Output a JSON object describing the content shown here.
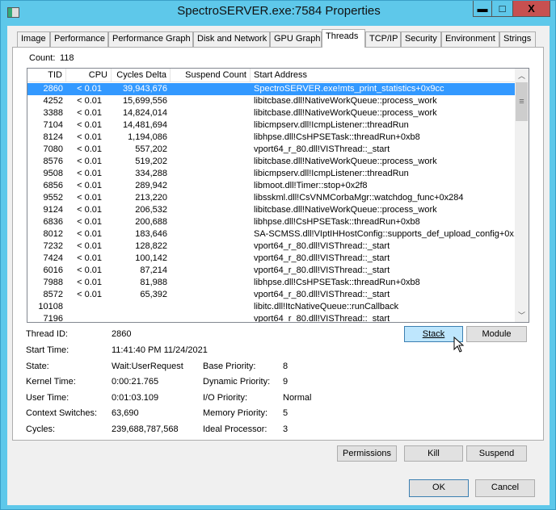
{
  "window": {
    "title": "SpectroSERVER.exe:7584 Properties",
    "minimize": "▬",
    "maximize": "□",
    "close": "X"
  },
  "tabs": [
    "Image",
    "Performance",
    "Performance Graph",
    "Disk and Network",
    "GPU Graph",
    "Threads",
    "TCP/IP",
    "Security",
    "Environment",
    "Strings"
  ],
  "selected_tab": "Threads",
  "count": {
    "label": "Count:",
    "value": "118"
  },
  "columns": [
    "TID",
    "CPU",
    "Cycles Delta",
    "Suspend Count",
    "Start Address"
  ],
  "rows": [
    [
      "2860",
      "< 0.01",
      "39,943,676",
      "",
      "SpectroSERVER.exe!mts_print_statistics+0x9cc"
    ],
    [
      "4252",
      "< 0.01",
      "15,699,556",
      "",
      "libitcbase.dll!NativeWorkQueue::process_work"
    ],
    [
      "3388",
      "< 0.01",
      "14,824,014",
      "",
      "libitcbase.dll!NativeWorkQueue::process_work"
    ],
    [
      "7104",
      "< 0.01",
      "14,481,694",
      "",
      "libicmpserv.dll!IcmpListener::threadRun"
    ],
    [
      "8124",
      "< 0.01",
      "1,194,086",
      "",
      "libhpse.dll!CsHPSETask::threadRun+0xb8"
    ],
    [
      "7080",
      "< 0.01",
      "557,202",
      "",
      "vport64_r_80.dll!VISThread::_start"
    ],
    [
      "8576",
      "< 0.01",
      "519,202",
      "",
      "libitcbase.dll!NativeWorkQueue::process_work"
    ],
    [
      "9508",
      "< 0.01",
      "334,288",
      "",
      "libicmpserv.dll!IcmpListener::threadRun"
    ],
    [
      "6856",
      "< 0.01",
      "289,942",
      "",
      "libmoot.dll!Timer::stop+0x2f8"
    ],
    [
      "9552",
      "< 0.01",
      "213,220",
      "",
      "libsskml.dll!CsVNMCorbaMgr::watchdog_func+0x284"
    ],
    [
      "9124",
      "< 0.01",
      "206,532",
      "",
      "libitcbase.dll!NativeWorkQueue::process_work"
    ],
    [
      "6836",
      "< 0.01",
      "200,688",
      "",
      "libhpse.dll!CsHPSETask::threadRun+0xb8"
    ],
    [
      "8012",
      "< 0.01",
      "183,646",
      "",
      "SA-SCMSS.dll!VIptIHHostConfig::supports_def_upload_config+0x..."
    ],
    [
      "7232",
      "< 0.01",
      "128,822",
      "",
      "vport64_r_80.dll!VISThread::_start"
    ],
    [
      "7424",
      "< 0.01",
      "100,142",
      "",
      "vport64_r_80.dll!VISThread::_start"
    ],
    [
      "6016",
      "< 0.01",
      "87,214",
      "",
      "vport64_r_80.dll!VISThread::_start"
    ],
    [
      "7988",
      "< 0.01",
      "81,988",
      "",
      "libhpse.dll!CsHPSETask::threadRun+0xb8"
    ],
    [
      "8572",
      "< 0.01",
      "65,392",
      "",
      "vport64_r_80.dll!VISThread::_start"
    ],
    [
      "10108",
      "",
      "",
      "",
      "libitc.dll!ItcNativeQueue::runCallback"
    ],
    [
      "7196",
      "",
      "",
      "",
      "vport64_r_80.dll!VISThread::_start"
    ]
  ],
  "details": {
    "thread_id": [
      "Thread ID:",
      "2860"
    ],
    "start_time": [
      "Start Time:",
      "11:41:40 PM   11/24/2021"
    ],
    "state": [
      "State:",
      "Wait:UserRequest"
    ],
    "kernel_time": [
      "Kernel Time:",
      "0:00:21.765"
    ],
    "user_time": [
      "User Time:",
      "0:01:03.109"
    ],
    "context_switches": [
      "Context Switches:",
      "63,690"
    ],
    "cycles": [
      "Cycles:",
      "239,688,787,568"
    ],
    "base_priority": [
      "Base Priority:",
      "8"
    ],
    "dynamic_priority": [
      "Dynamic Priority:",
      "9"
    ],
    "io_priority": [
      "I/O Priority:",
      "Normal"
    ],
    "memory_priority": [
      "Memory Priority:",
      "5"
    ],
    "ideal_processor": [
      "Ideal Processor:",
      "3"
    ]
  },
  "buttons": {
    "stack": "Stack",
    "module": "Module",
    "permissions": "Permissions",
    "kill": "Kill",
    "suspend": "Suspend",
    "ok": "OK",
    "cancel": "Cancel"
  }
}
